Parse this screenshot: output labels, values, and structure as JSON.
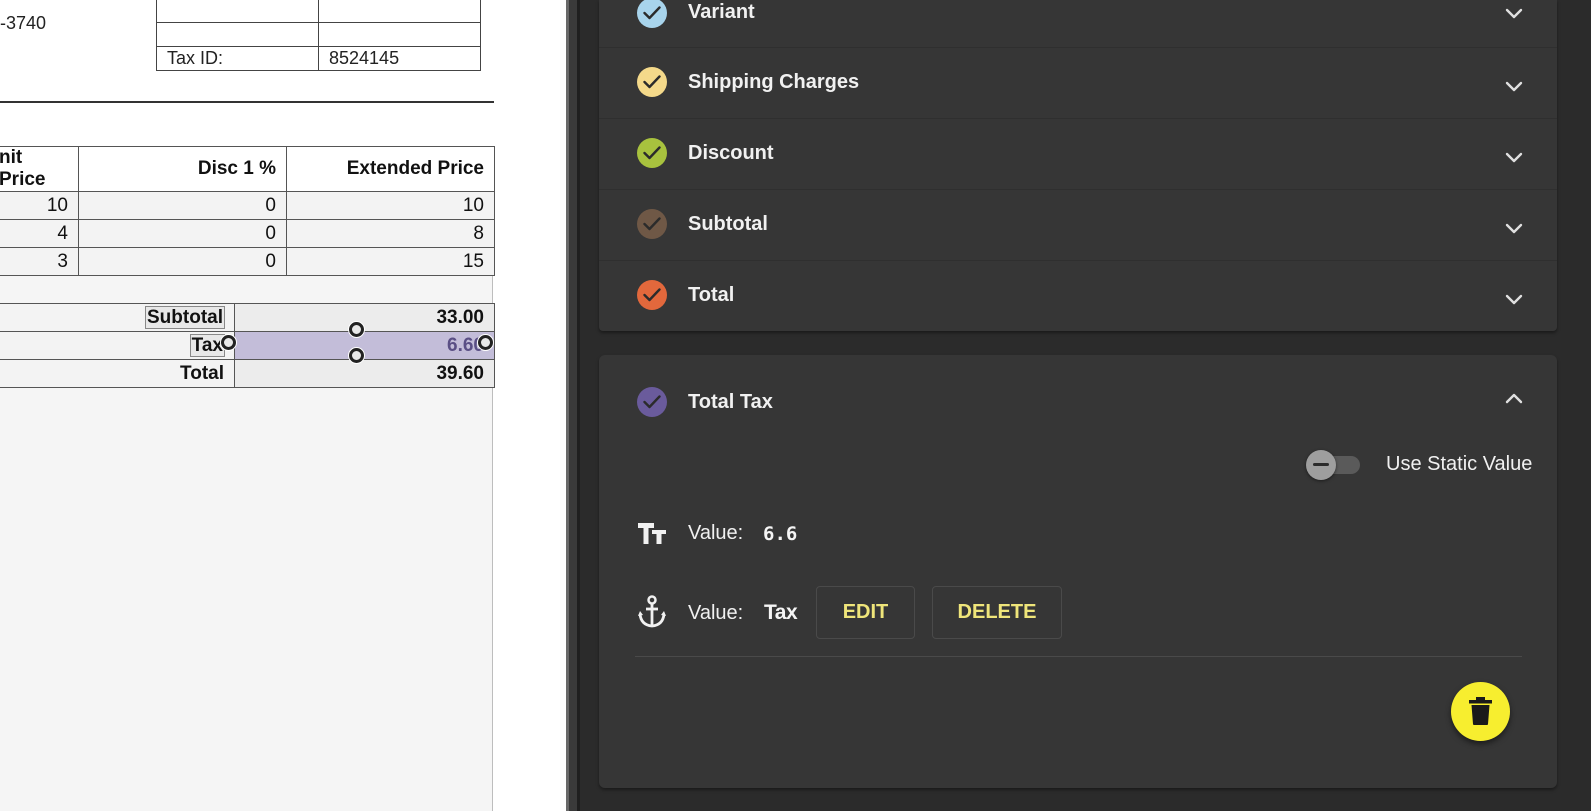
{
  "document": {
    "phone_fragment": "-3740",
    "header_table": {
      "rows": [
        [
          "",
          ""
        ],
        [
          "",
          ""
        ],
        [
          "Tax ID:",
          "8524145"
        ]
      ]
    },
    "items_table": {
      "headers": [
        "nit Price",
        "Disc 1 %",
        "Extended Price"
      ],
      "rows": [
        [
          "10",
          "0",
          "10"
        ],
        [
          "4",
          "0",
          "8"
        ],
        [
          "3",
          "0",
          "15"
        ]
      ]
    },
    "totals": [
      {
        "label": "Subtotal",
        "value": "33.00"
      },
      {
        "label": "Tax",
        "value": "6.60"
      },
      {
        "label": "Total",
        "value": "39.60"
      }
    ]
  },
  "panel": {
    "accordion_items": [
      {
        "label": "Variant",
        "color": "#a8d4ec"
      },
      {
        "label": "Shipping Charges",
        "color": "#f4d98a"
      },
      {
        "label": "Discount",
        "color": "#a8c23e"
      },
      {
        "label": "Subtotal",
        "color": "#6f5846"
      },
      {
        "label": "Total",
        "color": "#e2683c"
      }
    ],
    "expanded": {
      "label": "Total Tax",
      "color": "#6a5b9c",
      "toggle_label": "Use Static Value",
      "text_value_label": "Value:",
      "text_value": "6.6",
      "anchor_value_label": "Value:",
      "anchor_value": "Tax",
      "edit_label": "EDIT",
      "delete_label": "DELETE"
    }
  }
}
